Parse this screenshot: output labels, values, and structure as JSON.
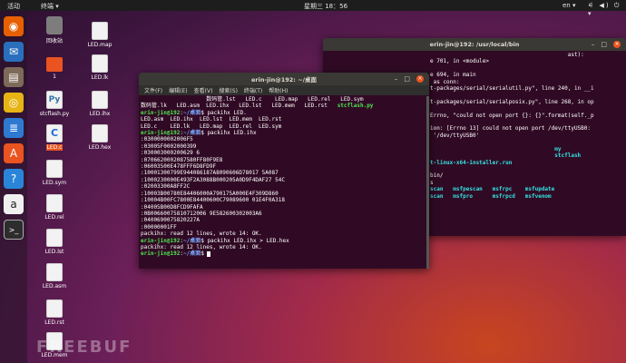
{
  "topbar": {
    "activities": "活动",
    "app_menu": "终端 ▾",
    "clock": "星期三 18：56",
    "lang": "en ▾",
    "system": "⚟ ◀) ⏻ ▾"
  },
  "dock": [
    {
      "name": "firefox",
      "glyph": "◉",
      "color": "#e66000"
    },
    {
      "name": "thunderbird",
      "glyph": "✉",
      "color": "#2a6fbd"
    },
    {
      "name": "files",
      "glyph": "▤",
      "color": "#7d6a58"
    },
    {
      "name": "rhythmbox",
      "glyph": "◎",
      "color": "#e7b416"
    },
    {
      "name": "writer",
      "glyph": "≣",
      "color": "#2e7ad1"
    },
    {
      "name": "software",
      "glyph": "A",
      "color": "#e95420"
    },
    {
      "name": "help",
      "glyph": "?",
      "color": "#2a85d9"
    },
    {
      "name": "amazon",
      "glyph": "a",
      "color": "#f0f0f0"
    },
    {
      "name": "terminal",
      "glyph": ">_",
      "color": "#2d2d2d"
    }
  ],
  "desktop_icons": [
    {
      "label": "回收站",
      "kind": "trash"
    },
    {
      "label": "LED.map",
      "kind": "file"
    },
    {
      "label": "1",
      "kind": "folder"
    },
    {
      "label": "LED.lk",
      "kind": "file"
    },
    {
      "label": "stcflash.py",
      "kind": "py"
    },
    {
      "label": "LED.ihx",
      "kind": "file"
    },
    {
      "label": "LED.c",
      "kind": "cfile"
    },
    {
      "label": "LED.hex",
      "kind": "file"
    },
    {
      "label": "LED.sym",
      "kind": "file"
    },
    {
      "label": "LED.rel",
      "kind": "file"
    },
    {
      "label": "LED.lst",
      "kind": "file"
    },
    {
      "label": "LED.asm",
      "kind": "file"
    },
    {
      "label": "LED.rst",
      "kind": "file"
    },
    {
      "label": "LED.mem",
      "kind": "file"
    }
  ],
  "back_window": {
    "title": "erin-jin@192: /usr/local/bin",
    "lines": [
      {
        "t": "                                          ast):",
        "cls": "w"
      },
      {
        "t": "e 701, in <module>",
        "cls": "w"
      },
      {
        "t": "",
        "cls": "w"
      },
      {
        "t": "e 694, in main",
        "cls": "w"
      },
      {
        "t": " as conn:",
        "cls": "w"
      },
      {
        "t": "t-packages/serial/serialutil.py\", line 240, in __i",
        "cls": "w"
      },
      {
        "t": "",
        "cls": "w"
      },
      {
        "t": "t-packages/serial/serialposix.py\", line 268, in op",
        "cls": "w"
      },
      {
        "t": "",
        "cls": "w"
      },
      {
        "t": "Errno, \"could not open port {}: {}\".format(self._p",
        "cls": "w"
      },
      {
        "t": "",
        "cls": "w"
      },
      {
        "t": "ion: [Errno 13] could not open port /dev/ttyUSB0:",
        "cls": "w"
      },
      {
        "t": " '/dev/ttyUSB0'",
        "cls": "w"
      },
      {
        "t": "",
        "cls": "w"
      },
      {
        "t": "                                      my",
        "cls": "c"
      },
      {
        "t": "                                      stcflash",
        "cls": "c"
      },
      {
        "t": "t-linux-x64-installer.run",
        "cls": "c"
      },
      {
        "t": "",
        "cls": "w"
      },
      {
        "t": "bin/",
        "cls": "w"
      },
      {
        "t": "s",
        "cls": "w"
      },
      {
        "t": "scan   msfpescan   msfrpc    msfupdate",
        "cls": "c"
      },
      {
        "t": "scan   msfpro      msfrpcd   msfvenom",
        "cls": "c"
      },
      {
        "t": "",
        "cls": "w"
      }
    ]
  },
  "front_window": {
    "title": "erin-jin@192: ~/桌面",
    "menu": [
      "文件(F)",
      "编辑(E)",
      "查看(V)",
      "搜索(S)",
      "终端(T)",
      "帮助(H)"
    ],
    "lines": [
      [
        {
          "t": "                    数码管.lst   LED.c    LED.map   LED.rel   LED.sym",
          "c": "w"
        }
      ],
      [
        {
          "t": "数码管.lk   LED.asm  LED.ihx   LED.lst   LED.mem   LED.rst   ",
          "c": "w"
        },
        {
          "t": "stcflash.py",
          "c": "g"
        }
      ],
      [
        {
          "t": "erin-jin@192",
          "c": "g"
        },
        {
          "t": ":",
          "c": "w"
        },
        {
          "t": "~/桌面",
          "c": "b"
        },
        {
          "t": "$ packihx LED.",
          "c": "w"
        }
      ],
      [
        {
          "t": "LED.asm  LED.ihx  LED.lst  LED.mem  LED.rst",
          "c": "w"
        }
      ],
      [
        {
          "t": "LED.c    LED.lk   LED.map  LED.rel  LED.sym",
          "c": "w"
        }
      ],
      [
        {
          "t": "erin-jin@192",
          "c": "g"
        },
        {
          "t": ":",
          "c": "w"
        },
        {
          "t": "~/桌面",
          "c": "b"
        },
        {
          "t": "$ packihx LED.ihx",
          "c": "w"
        }
      ],
      [
        {
          "t": ":0300000002006F5",
          "c": "w"
        }
      ],
      [
        {
          "t": ":03005F0002000399",
          "c": "w"
        }
      ],
      [
        {
          "t": ":030003000200629 6",
          "c": "w"
        }
      ],
      [
        {
          "t": ":0706620002087580FF80F9E8",
          "c": "w"
        }
      ],
      [
        {
          "t": ":06003500E478FFF6D8FD9F",
          "c": "w"
        }
      ],
      [
        {
          "t": ":10001300799E944086187A8090606D78017 5A087",
          "c": "w"
        }
      ],
      [
        {
          "t": ":1000230000E493F2A3088B000205A0D9F4DAF27 54C",
          "c": "w"
        }
      ],
      [
        {
          "t": ":02003300A8FF2C",
          "c": "w"
        }
      ],
      [
        {
          "t": ":10003B00780E84406000A790175A000E4F309D860",
          "c": "w"
        }
      ],
      [
        {
          "t": ":10004B00FC7800E84400600C79089600 01E4F0A318",
          "c": "w"
        }
      ],
      [
        {
          "t": ":04005B00D8FCD9FAFA",
          "c": "w"
        }
      ],
      [
        {
          "t": ":0B00660075810712006 9E582600302003A6",
          "c": "w"
        }
      ],
      [
        {
          "t": ":0400690075820227A",
          "c": "w"
        }
      ],
      [
        {
          "t": ":00000001FF",
          "c": "w"
        }
      ],
      [
        {
          "t": "packihx: read 12 lines, wrote 14: OK.",
          "c": "w"
        }
      ],
      [
        {
          "t": "erin-jin@192",
          "c": "g"
        },
        {
          "t": ":",
          "c": "w"
        },
        {
          "t": "~/桌面",
          "c": "b"
        },
        {
          "t": "$ packihx LED.ihx > LED.hex",
          "c": "w"
        }
      ],
      [
        {
          "t": "packihx: read 12 lines, wrote 14: OK.",
          "c": "w"
        }
      ],
      [
        {
          "t": "erin-jin@192",
          "c": "g"
        },
        {
          "t": ":",
          "c": "w"
        },
        {
          "t": "~/桌面",
          "c": "b"
        },
        {
          "t": "$ ",
          "c": "w"
        }
      ]
    ]
  },
  "watermark": "FREEBUF"
}
